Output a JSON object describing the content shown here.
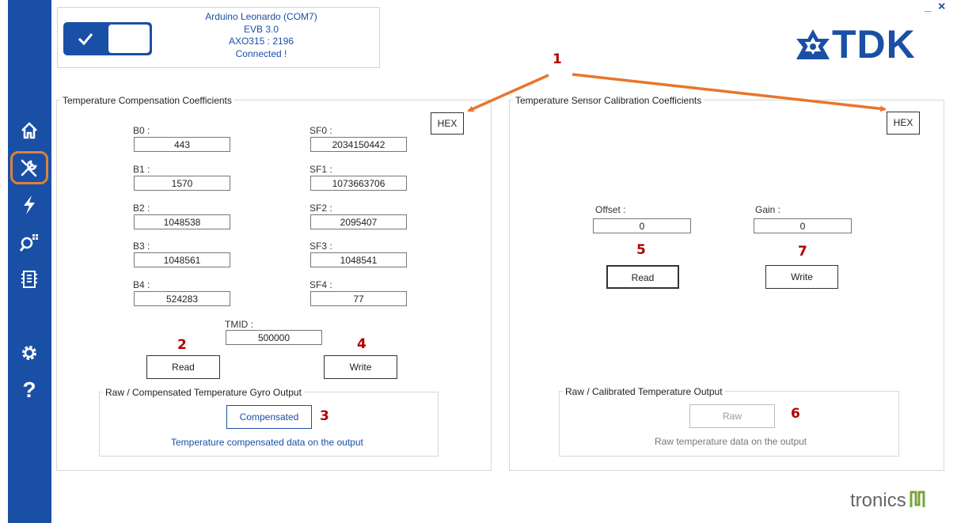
{
  "window": {
    "minimize_label": "_",
    "close_label": "×"
  },
  "connection": {
    "line1": "Arduino Leonardo (COM7)",
    "line2": "EVB 3.0",
    "line3": "AXO315 : 2196",
    "line4": "Connected !",
    "toggle_icon": "check-icon"
  },
  "logo": {
    "text": "TDK",
    "color": "#1a4fa6"
  },
  "footer_logo": {
    "text": "tronics"
  },
  "sidebar": {
    "bg_color": "#1a4fa6",
    "items": [
      "home-icon",
      "tools-icon",
      "lightning-icon",
      "search-icon",
      "chip-icon",
      "gear-icon",
      "help-icon"
    ],
    "active": "tools-icon",
    "help_glyph": "?"
  },
  "left_panel": {
    "title": "Temperature Compensation Coefficients",
    "hex_label": "HEX",
    "fields": {
      "b0": {
        "label": "B0 :",
        "value": "443"
      },
      "b1": {
        "label": "B1 :",
        "value": "1570"
      },
      "b2": {
        "label": "B2 :",
        "value": "1048538"
      },
      "b3": {
        "label": "B3 :",
        "value": "1048561"
      },
      "b4": {
        "label": "B4 :",
        "value": "524283"
      },
      "sf0": {
        "label": "SF0 :",
        "value": "2034150442"
      },
      "sf1": {
        "label": "SF1 :",
        "value": "1073663706"
      },
      "sf2": {
        "label": "SF2 :",
        "value": "2095407"
      },
      "sf3": {
        "label": "SF3 :",
        "value": "1048541"
      },
      "sf4": {
        "label": "SF4 :",
        "value": "77"
      },
      "tmid": {
        "label": "TMID :",
        "value": "500000"
      }
    },
    "read_label": "Read",
    "write_label": "Write",
    "output": {
      "title": "Raw / Compensated Temperature Gyro Output",
      "button_label": "Compensated",
      "status": "Temperature compensated data on the output"
    }
  },
  "right_panel": {
    "title": "Temperature Sensor Calibration Coefficients",
    "hex_label": "HEX",
    "offset": {
      "label": "Offset :",
      "value": "0"
    },
    "gain": {
      "label": "Gain :",
      "value": "0"
    },
    "read_label": "Read",
    "write_label": "Write",
    "output": {
      "title": "Raw / Calibrated Temperature Output",
      "button_label": "Raw",
      "status": "Raw temperature data on the output"
    }
  },
  "annotations": {
    "n1": "1",
    "n2": "2",
    "n3": "3",
    "n4": "4",
    "n5": "5",
    "n6": "6",
    "n7": "7",
    "number_color": "#b00000",
    "arrow_color": "#e8762b"
  }
}
